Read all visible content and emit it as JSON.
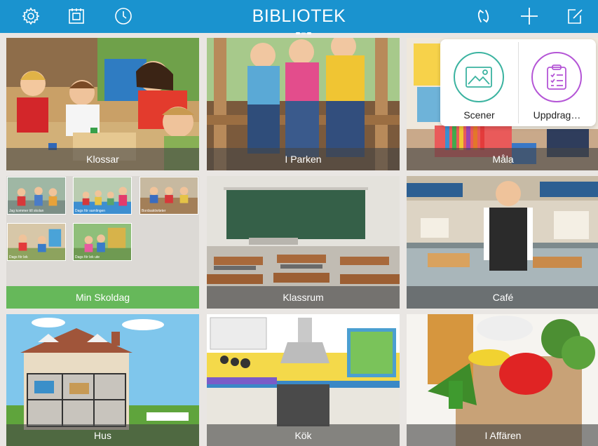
{
  "header": {
    "title": "BIBLIOTEK",
    "bg_color": "#1a93cf",
    "left_icons": [
      "gear-icon",
      "calendar-frame-icon",
      "clock-icon"
    ],
    "right_icons": [
      "reorder-icon",
      "plus-icon",
      "edit-icon"
    ]
  },
  "popover": {
    "items": [
      {
        "label": "Scener",
        "icon": "image-icon",
        "color": "#3bb3a0"
      },
      {
        "label": "Uppdrag…",
        "icon": "clipboard-icon",
        "color": "#b455d6"
      }
    ]
  },
  "tiles": [
    {
      "label": "Klossar",
      "theme": "kids-blocks"
    },
    {
      "label": "I Parken",
      "theme": "kids-park"
    },
    {
      "label": "Måla",
      "theme": "painting"
    },
    {
      "label": "Min Skoldag",
      "theme": "collection",
      "caption_color": "#66b85a"
    },
    {
      "label": "Klassrum",
      "theme": "classroom"
    },
    {
      "label": "Café",
      "theme": "cafe"
    },
    {
      "label": "Hus",
      "theme": "house"
    },
    {
      "label": "Kök",
      "theme": "kitchen"
    },
    {
      "label": "I Affären",
      "theme": "grocery"
    }
  ],
  "skoldag_thumbs": [
    "Jag kommer till skolan",
    "Dags för samlingen",
    "Bordsaktiviteter",
    "Dags för lek",
    "Dags för lek ute"
  ]
}
